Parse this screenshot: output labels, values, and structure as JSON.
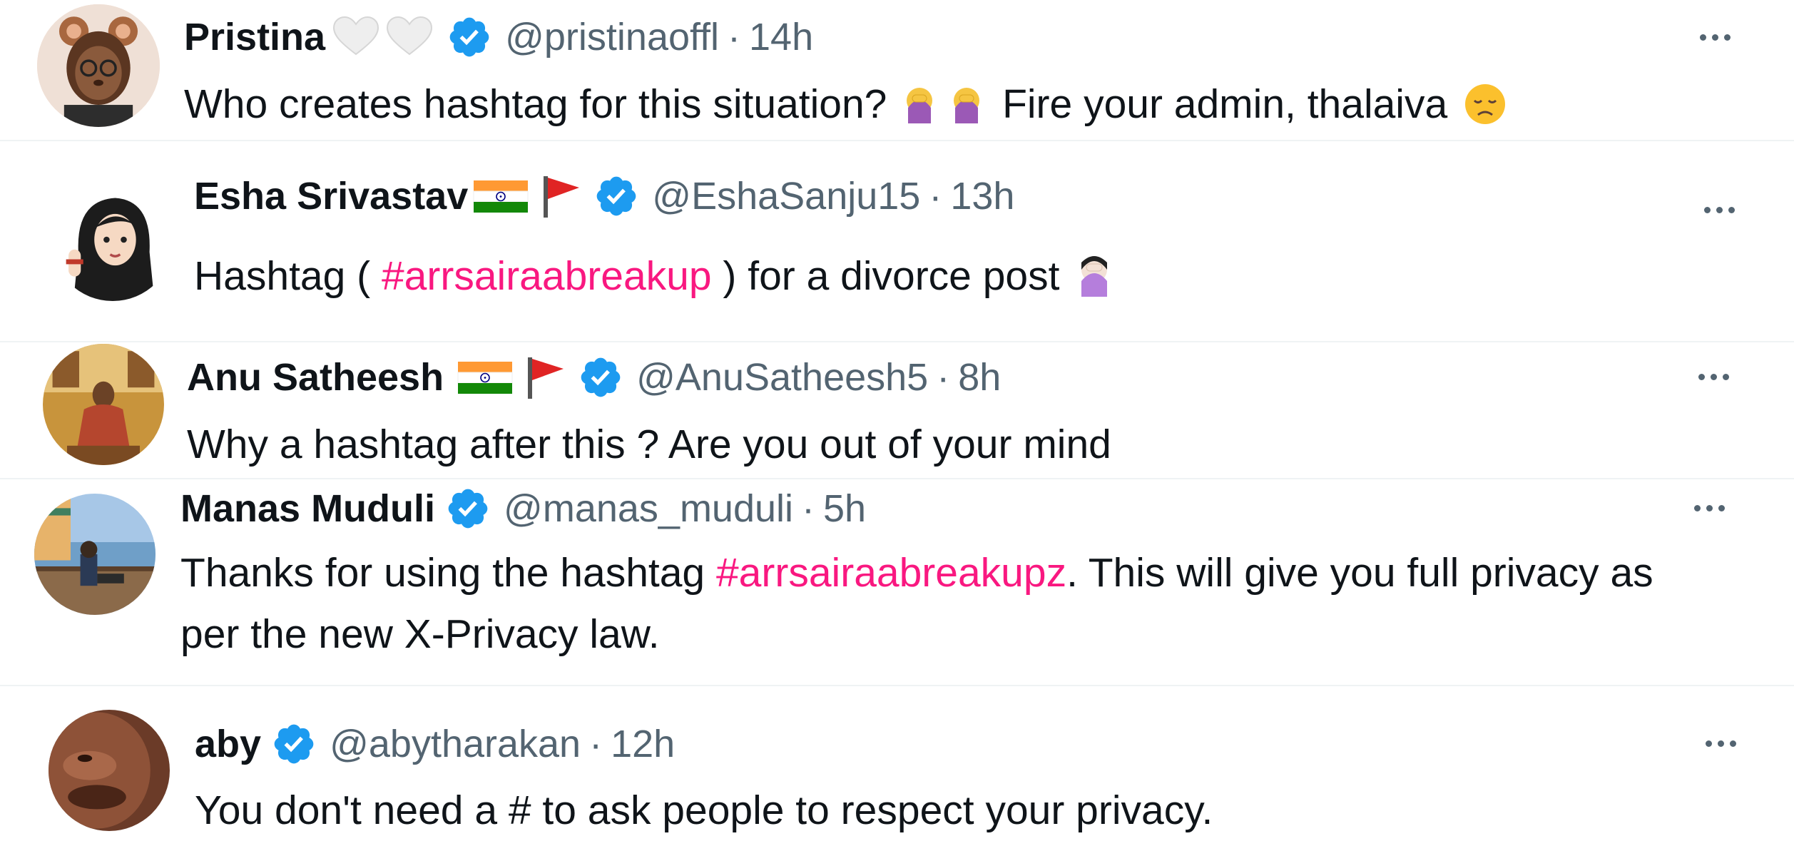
{
  "replies": [
    {
      "name": "Pristina",
      "handle": "@pristinaoffl",
      "time": "14h",
      "text_a": "Who creates hashtag for this situation?",
      "text_b": "Fire your admin, thalaiva"
    },
    {
      "name": "Esha Srivastav",
      "handle": "@EshaSanju15",
      "time": "13h",
      "text_a": "Hashtag (",
      "hashtag": "#arrsairaabreakup",
      "text_b": ") for a divorce post"
    },
    {
      "name": "Anu Satheesh",
      "handle": "@AnuSatheesh5",
      "time": "8h",
      "text": "Why a hashtag after this ? Are you out of your mind"
    },
    {
      "name": "Manas Muduli",
      "handle": "@manas_muduli",
      "time": "5h",
      "text_a": "Thanks for using the hashtag",
      "hashtag": "#arrsairaabreakupz",
      "text_b": ". This will give you full privacy as per the new X-Privacy law."
    },
    {
      "name": "aby",
      "handle": "@abytharakan",
      "time": "12h",
      "text": "You don't need a # to ask people to respect your privacy."
    }
  ],
  "separator": "·",
  "colors": {
    "text": "#0f1419",
    "secondary": "#536471",
    "verified": "#1d9bf0",
    "hashtag": "#f91880"
  }
}
